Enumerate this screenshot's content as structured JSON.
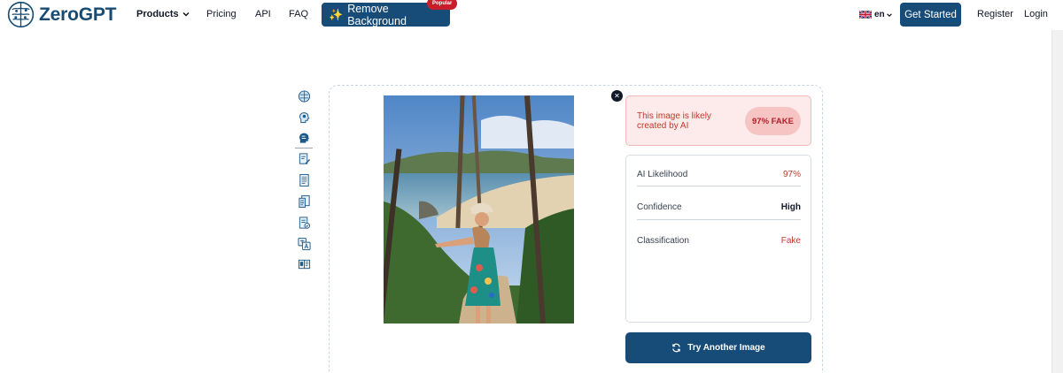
{
  "nav": {
    "brand": "ZeroGPT",
    "products": "Products",
    "pricing": "Pricing",
    "api": "API",
    "faq": "FAQ",
    "remove_background": "Remove Background",
    "popular_badge": "Popular",
    "language": "en",
    "get_started": "Get Started",
    "register": "Register",
    "login": "Login"
  },
  "tools": [
    {
      "icon": "brain-circuit-icon",
      "active": false
    },
    {
      "icon": "head-profile-icon",
      "active": false
    },
    {
      "icon": "ai-face-icon",
      "active": true
    },
    {
      "icon": "document-edit-icon",
      "active": false
    },
    {
      "icon": "document-lines-icon",
      "active": false
    },
    {
      "icon": "document-compare-icon",
      "active": false
    },
    {
      "icon": "document-check-icon",
      "active": false
    },
    {
      "icon": "translate-icon",
      "active": false
    },
    {
      "icon": "book-icon",
      "active": false
    }
  ],
  "result": {
    "alert_text": "This image is likely created by AI",
    "badge": "97% FAKE",
    "rows": [
      {
        "label": "AI Likelihood",
        "value": "97%",
        "tone": "red"
      },
      {
        "label": "Confidence",
        "value": "High",
        "tone": "dark"
      },
      {
        "label": "Classification",
        "value": "Fake",
        "tone": "red"
      }
    ],
    "try_again": "Try Another Image"
  },
  "colors": {
    "brand": "#174c79",
    "alert_bg": "#fdeaea",
    "alert_text": "#c0392b",
    "badge_bg": "#f7c4c4"
  }
}
